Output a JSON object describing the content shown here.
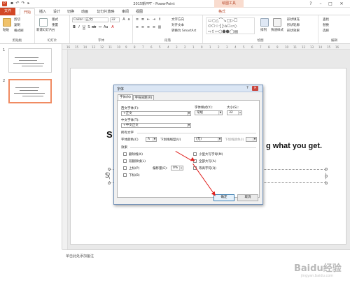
{
  "window": {
    "title": "2015新PPT - PowerPoint",
    "tool_context": "绘图工具"
  },
  "tabs": {
    "file": "文件",
    "items": [
      "开始",
      "插入",
      "设计",
      "切换",
      "动画",
      "幻灯片放映",
      "审阅",
      "视图",
      "格式"
    ]
  },
  "ribbon": {
    "clipboard": {
      "paste": "粘贴",
      "cut": "剪切",
      "copy": "复制",
      "format_painter": "格式刷",
      "group": "剪贴板"
    },
    "slides": {
      "new_slide": "新建幻灯片",
      "layout": "版式",
      "reset": "重置",
      "section": "节",
      "group": "幻灯片"
    },
    "font": {
      "font_name": "Calibri (正文)",
      "font_size": "32",
      "group": "字体"
    },
    "paragraph": {
      "text_direction": "文字方向",
      "align_text": "对齐文本",
      "smartart": "转换为 SmartArt",
      "group": "段落"
    },
    "drawing": {
      "arrange": "排列",
      "quick_styles": "快速样式",
      "shape_fill": "形状填充",
      "shape_outline": "形状轮廓",
      "shape_effects": "形状效果",
      "group": "绘图"
    },
    "editing": {
      "find": "查找",
      "replace": "替换",
      "select": "选择",
      "group": "编辑"
    }
  },
  "thumbnails": [
    {
      "number": "1"
    },
    {
      "number": "2"
    }
  ],
  "ruler": {
    "ticks": [
      "16",
      "15",
      "14",
      "13",
      "12",
      "11",
      "10",
      "9",
      "8",
      "7",
      "6",
      "5",
      "4",
      "3",
      "2",
      "1",
      "0",
      "1",
      "2",
      "3",
      "4",
      "5",
      "6",
      "7",
      "8",
      "9",
      "10",
      "11",
      "12",
      "13",
      "14",
      "15",
      "16"
    ]
  },
  "slide": {
    "text_left": "S",
    "text_right": "g what you get.",
    "placeholder_text": "S"
  },
  "notes": {
    "placeholder": "单击此处添加备注"
  },
  "dialog": {
    "title": "字体",
    "help_icon": "?",
    "close_icon": "✕",
    "tabs": [
      "字体(N)",
      "字符间距(R)"
    ],
    "western_font_label": "西文字体(F):",
    "western_font_value": "+正文",
    "font_style_label": "字体样式(Y):",
    "font_style_value": "常规",
    "size_label": "大小(S):",
    "size_value": "32",
    "asian_font_label": "中文字体(T):",
    "asian_font_value": "+中文正文",
    "all_text_label": "所有文字",
    "font_color_label": "字体颜色(C)",
    "underline_style_label": "下划线线型(U)",
    "underline_style_value": "(无)",
    "underline_color_label": "下划线颜色(I)",
    "effects_label": "效果",
    "strikethrough": "删除线(K)",
    "double_strikethrough": "双删除线(L)",
    "superscript": "上标(P)",
    "subscript": "下标(B)",
    "offset_label": "偏移量(E):",
    "offset_value": "0%",
    "small_caps": "小型大写字母(M)",
    "all_caps": "全部大写(A)",
    "equalize_height": "等高字符(Q)",
    "ok": "确定",
    "cancel": "取消"
  },
  "watermark": {
    "text": "Baidu经验",
    "sub": "jingyan.baidu.com"
  },
  "colors": {
    "accent": "#d24726",
    "dialog_border": "#6f8fb7",
    "annotation": "#e0201e"
  }
}
